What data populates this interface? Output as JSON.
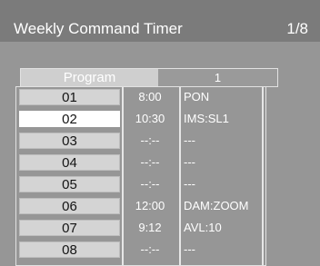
{
  "header": {
    "title": "Weekly Command Timer",
    "page_indicator": "1/8"
  },
  "program": {
    "label": "Program",
    "value": "1"
  },
  "rows": [
    {
      "day": "01",
      "time": "8:00",
      "command": "PON"
    },
    {
      "day": "02",
      "time": "10:30",
      "command": "IMS:SL1"
    },
    {
      "day": "03",
      "time": "--:--",
      "command": "---"
    },
    {
      "day": "04",
      "time": "--:--",
      "command": "---"
    },
    {
      "day": "05",
      "time": "--:--",
      "command": "---"
    },
    {
      "day": "06",
      "time": "12:00",
      "command": "DAM:ZOOM"
    },
    {
      "day": "07",
      "time": "9:12",
      "command": "AVL:10"
    },
    {
      "day": "08",
      "time": "--:--",
      "command": "---"
    }
  ],
  "selected_row": "02",
  "colors": {
    "background": "#969696",
    "titlebar": "#7b7b7b",
    "cell_normal": "#d4d4d4",
    "cell_selected": "#ffffff",
    "text_light": "#ffffff",
    "text_dark": "#141414"
  }
}
